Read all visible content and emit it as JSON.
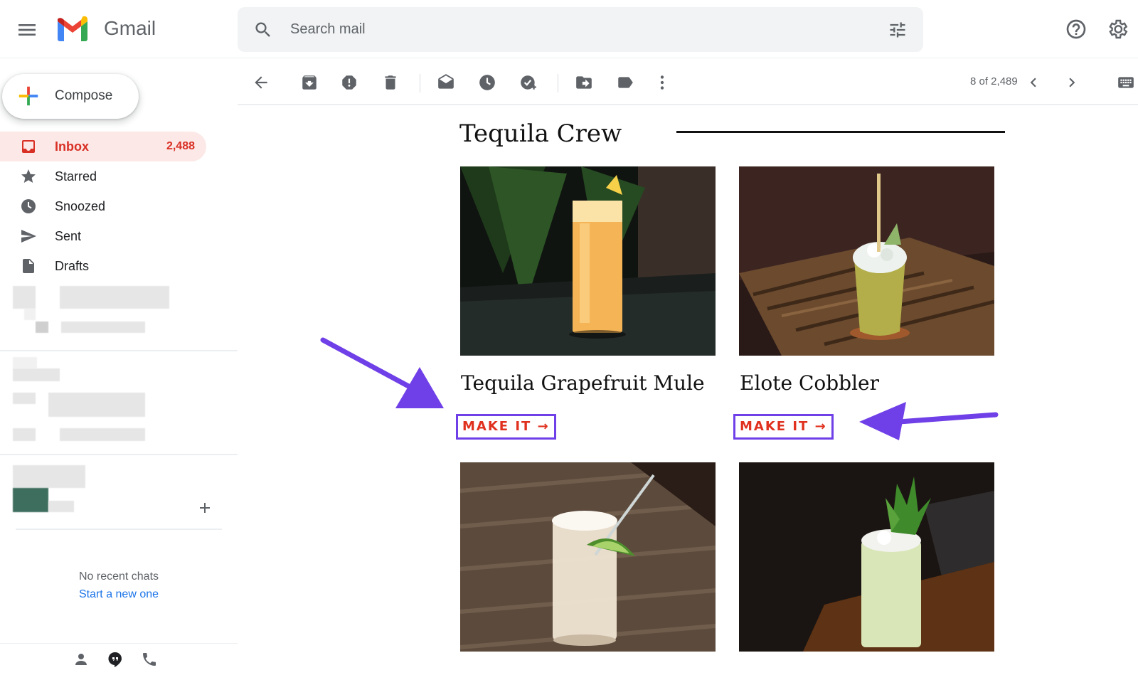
{
  "app": {
    "name": "Gmail"
  },
  "search": {
    "placeholder": "Search mail"
  },
  "sidebar": {
    "compose_label": "Compose",
    "items": [
      {
        "label": "Inbox",
        "count": "2,488",
        "icon": "inbox-icon",
        "active": true
      },
      {
        "label": "Starred",
        "count": "",
        "icon": "star-icon"
      },
      {
        "label": "Snoozed",
        "count": "",
        "icon": "clock-icon"
      },
      {
        "label": "Sent",
        "count": "",
        "icon": "send-icon"
      },
      {
        "label": "Drafts",
        "count": "",
        "icon": "draft-icon"
      }
    ],
    "chat": {
      "empty_text": "No recent chats",
      "start_link": "Start a new one"
    }
  },
  "toolbar": {
    "pager": "8 of 2,489"
  },
  "email": {
    "section_title": "Tequila Crew",
    "cards": [
      {
        "title": "Tequila Grapefruit Mule",
        "cta": "MAKE IT →"
      },
      {
        "title": "Elote Cobbler",
        "cta": "MAKE IT →"
      }
    ]
  },
  "colors": {
    "accent_red": "#d93025",
    "annotation_purple": "#6f3fe8",
    "cta_red": "#e0301e"
  }
}
